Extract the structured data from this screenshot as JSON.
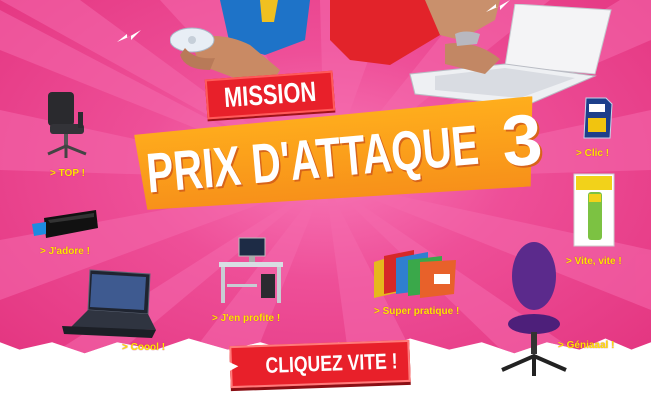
{
  "banner": {
    "badge": "MISSION",
    "title": "PRIX D'ATTAQUE",
    "number": "3",
    "cta_arrow": "►",
    "cta_label": "CLIQUEZ VITE !"
  },
  "products": [
    {
      "label": "> TOP !",
      "icon": "office-chair-icon"
    },
    {
      "label": "> J'adore !",
      "icon": "usb-drive-icon"
    },
    {
      "label": "> Coool !",
      "icon": "laptop-icon"
    },
    {
      "label": "> J'en profite !",
      "icon": "computer-desk-icon"
    },
    {
      "label": "> Super pratique !",
      "icon": "folders-icon"
    },
    {
      "label": "> Clic !",
      "icon": "sd-card-icon"
    },
    {
      "label": "> Vite, vite !",
      "icon": "glue-stick-icon"
    },
    {
      "label": "> Géniaaal !",
      "icon": "purple-chair-icon"
    }
  ],
  "colors": {
    "background": "#ee4f98",
    "label": "#ffe600",
    "badge": "#e8202a",
    "title_panel": "#f7901a"
  }
}
